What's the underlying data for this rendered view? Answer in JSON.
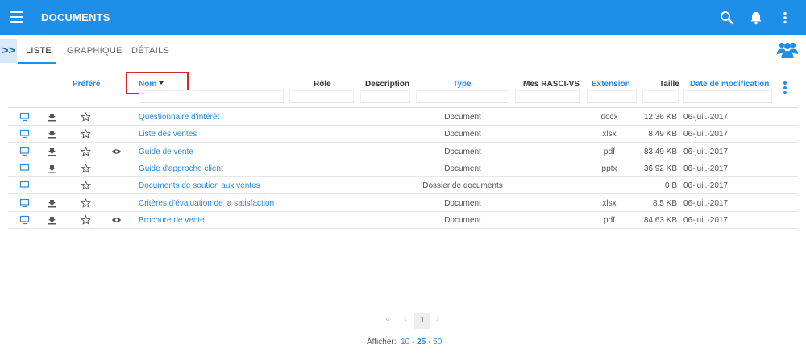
{
  "app": {
    "title": "DOCUMENTS"
  },
  "icons": {
    "menu": "hamburger-icon",
    "search": "search-icon",
    "notifications": "bell-icon",
    "more": "more-vert-icon",
    "users": "users-icon"
  },
  "colors": {
    "accent": "#1e8fe8",
    "link": "#2a8ae2",
    "highlight_border": "#d9262e"
  },
  "tabs": [
    {
      "label": "LISTE",
      "active": true
    },
    {
      "label": "GRAPHIQUE",
      "active": false
    },
    {
      "label": "DÉTAILS",
      "active": false
    }
  ],
  "expander": {
    "label": ">>"
  },
  "table": {
    "headers": {
      "prefere": "Préféré",
      "nom": "Nom",
      "role": "Rôle",
      "description": "Description",
      "type": "Type",
      "rasci": "Mes RASCI-VS",
      "extension": "Extension",
      "taille": "Taille",
      "date": "Date de modification"
    },
    "rows": [
      {
        "name": "Questionnaire d'intérêt",
        "type": "Document",
        "ext": "docx",
        "size": "12.36 KB",
        "date": "06-juil.-2017",
        "download": true,
        "view": false
      },
      {
        "name": "Liste des ventes",
        "type": "Document",
        "ext": "xlsx",
        "size": "8.49 KB",
        "date": "06-juil.-2017",
        "download": true,
        "view": false
      },
      {
        "name": "Guide de vente",
        "type": "Document",
        "ext": "pdf",
        "size": "83.49 KB",
        "date": "06-juil.-2017",
        "download": true,
        "view": true
      },
      {
        "name": "Guide d'approche client",
        "type": "Document",
        "ext": "pptx",
        "size": "36.92 KB",
        "date": "06-juil.-2017",
        "download": true,
        "view": false
      },
      {
        "name": "Documents de soutien aux ventes",
        "type": "Dossier de documents",
        "ext": "",
        "size": "0 B",
        "date": "06-juil.-2017",
        "download": false,
        "view": false
      },
      {
        "name": "Critères d'évaluation de la satisfaction",
        "type": "Document",
        "ext": "xlsx",
        "size": "8.5 KB",
        "date": "06-juil.-2017",
        "download": true,
        "view": false
      },
      {
        "name": "Brochure de vente",
        "type": "Document",
        "ext": "pdf",
        "size": "84.63 KB",
        "date": "06-juil.-2017",
        "download": true,
        "view": true
      }
    ]
  },
  "pagination": {
    "first": "«",
    "prev": "‹",
    "current": "1",
    "next": "›"
  },
  "page_size": {
    "label": "Afficher:",
    "options": [
      "10",
      "25",
      "50"
    ],
    "selected": "25",
    "separator": "-"
  }
}
